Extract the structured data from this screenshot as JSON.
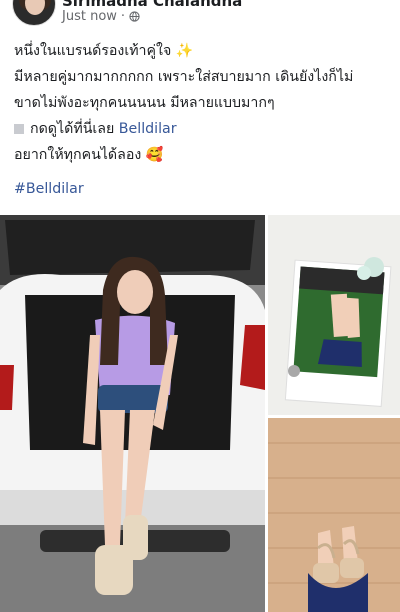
{
  "post": {
    "author": "Sirimadna Chalandha",
    "time": "Just now",
    "privacy_icon": "globe-icon",
    "lines": [
      "หนึ่งในแบรนด์รองเท้าคู่ใจ ✨",
      "มีหลายคู่มากมากกกกก เพราะใส่สบายมาก เดินยังไงก็ไม่",
      "ขาดไม่พังอะทุกคนนนนน มีหลายแบบมากๆ"
    ],
    "cta_text": "กดดูได้ที่นี่เลย",
    "cta_link": "Belldilar",
    "last_line": "อยากให้ทุกคนได้ลอง 🥰",
    "hashtag": "#Belldilar"
  },
  "photos": {
    "main_alt": "woman-sitting-in-car-trunk",
    "top_right_alt": "polaroid-feet-on-grass",
    "bottom_right_alt": "feet-sandals-wood-floor"
  },
  "colors": {
    "link": "#385898",
    "text": "#1c1e21",
    "meta": "#65676b"
  }
}
